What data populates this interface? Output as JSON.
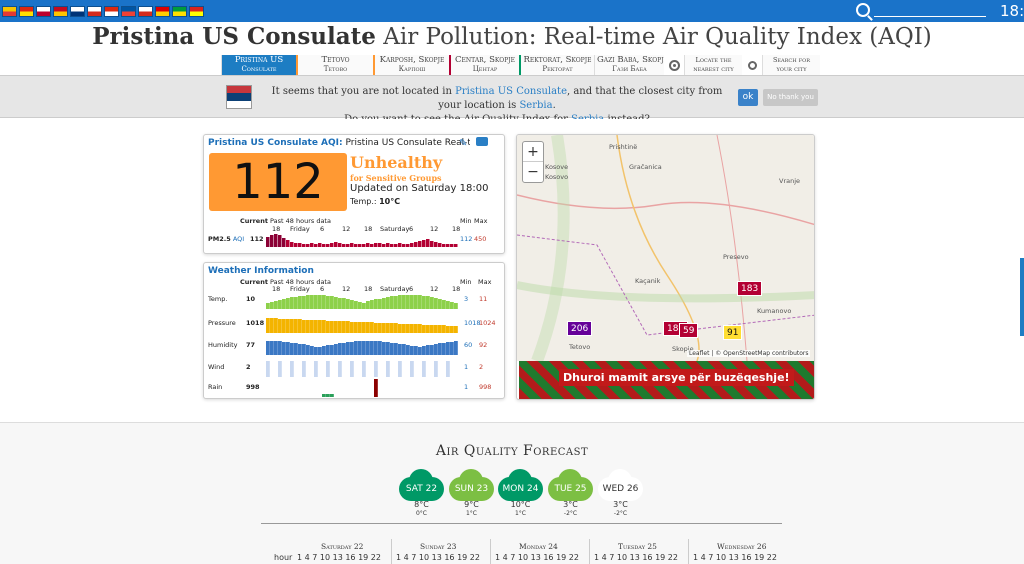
{
  "top_bar": {
    "flag_colors": [
      [
        "#f5c400",
        "#e53935"
      ],
      [
        "#de2910",
        "#ffde00"
      ],
      [
        "#ffffff",
        "#bc002d"
      ],
      [
        "#c60b1e",
        "#ffc400"
      ],
      [
        "#ffffff",
        "#003478"
      ],
      [
        "#ffffff",
        "#d52b1e"
      ],
      [
        "#de2910",
        "#ffffff"
      ],
      [
        "#0055a4",
        "#ef4135"
      ],
      [
        "#ffffff",
        "#d52b1e"
      ],
      [
        "#dd0000",
        "#ffce00"
      ],
      [
        "#009c3b",
        "#ffdf00"
      ],
      [
        "#da251d",
        "#ffff00"
      ]
    ],
    "clock": "18:"
  },
  "page_title": {
    "bold": "Pristina US Consulate",
    "rest": " Air Pollution: Real-time Air Quality Index (AQI)"
  },
  "nav": [
    {
      "label": "Pristina US",
      "sub": "Consulate",
      "active": true,
      "accent": ""
    },
    {
      "label": "Tetovo",
      "sub": "Тетово",
      "active": false,
      "accent": "#ff9933"
    },
    {
      "label": "Karposh, Skopje",
      "sub": "Карпош",
      "active": false,
      "accent": "#ff9933"
    },
    {
      "label": "Centar, Skopje",
      "sub": "Центар",
      "active": false,
      "accent": "#b30033"
    },
    {
      "label": "Rektorat, Skopje",
      "sub": "Ректорат",
      "active": false,
      "accent": "#009966"
    },
    {
      "label": "Gazi Baba, Skopje",
      "sub": "Гази Баба",
      "active": false,
      "accent": ""
    },
    {
      "label": "Locate the",
      "sub": "nearest city",
      "active": false,
      "accent": ""
    },
    {
      "label": "Search for",
      "sub": "your city",
      "active": false,
      "accent": ""
    }
  ],
  "notice": {
    "line1_a": "It seems that you are not located in ",
    "line1_link": "Pristina US Consulate",
    "line1_b": ", and that the closest city from your location is ",
    "line1_link2": "Serbia",
    "line1_c": ".",
    "line2_a": "Do you want to see the Air Quality Index for ",
    "line2_link": "Serbia",
    "line2_b": " instead?",
    "ok": "ok",
    "no": "No thank you"
  },
  "aqi_card": {
    "title_blue": "Pristina US Consulate AQI:",
    "title_rest": " Pristina US Consulate Real-time Air Q",
    "value": "112",
    "status": "Unhealthy",
    "status_sub": "for Sensitive Groups",
    "updated": "Updated on Saturday 18:00",
    "temp_label": "Temp.:",
    "temp_value": "10°C",
    "hdr_current": "Current",
    "hdr_past": "Past 48 hours data",
    "hdr_min": "Min",
    "hdr_max": "Max",
    "pm_label": "PM2.5",
    "pm_unit": "AQI",
    "pm_current": "112",
    "pm_min": "112",
    "pm_max": "450",
    "tick_labels": [
      "18",
      "Friday",
      "6",
      "12",
      "18",
      "Saturday",
      "6",
      "12",
      "18"
    ]
  },
  "weather_card": {
    "title": "Weather Information",
    "hdr_current": "Current",
    "hdr_past": "Past 48 hours data",
    "hdr_min": "Min",
    "hdr_max": "Max",
    "tick_labels": [
      "18",
      "Friday",
      "6",
      "12",
      "18",
      "Saturday",
      "6",
      "12",
      "18"
    ],
    "rows": [
      {
        "label": "Temp.",
        "current": "10",
        "min": "3",
        "max": "11",
        "color": "#8dd14a"
      },
      {
        "label": "Pressure",
        "current": "1018",
        "min": "1018",
        "max": "1024",
        "color": "#f4b400"
      },
      {
        "label": "Humidity",
        "current": "77",
        "min": "60",
        "max": "92",
        "color": "#3b78c4"
      },
      {
        "label": "Wind",
        "current": "2",
        "min": "1",
        "max": "2",
        "color": "#c9d8f0"
      },
      {
        "label": "Rain",
        "current": "998",
        "min": "1",
        "max": "998",
        "color": "#8b0000"
      }
    ]
  },
  "map": {
    "zoom_in": "+",
    "zoom_out": "−",
    "attribution": "Leaflet | © OpenStreetMap contributors",
    "labels": [
      "Prishtinë",
      "Gračanica",
      "Kosove",
      "Kosovo",
      "Kumanovo",
      "Presevo",
      "Tetovo",
      "Skopje",
      "Kaçanik",
      "Vranje"
    ],
    "markers": [
      {
        "value": "206",
        "color": "#660099"
      },
      {
        "value": "182",
        "color": "#b30033"
      },
      {
        "value": "59",
        "color": "#b30033"
      },
      {
        "value": "183",
        "color": "#b30033"
      },
      {
        "value": "91",
        "color": "#ffde33"
      }
    ],
    "ad_text": "Dhuroi mamit arsye për buzëqeshje!"
  },
  "forecast": {
    "title": "Air Quality Forecast",
    "days": [
      {
        "label": "SAT 22",
        "hi": "8°C",
        "lo": "0°C",
        "color": "#009966"
      },
      {
        "label": "SUN 23",
        "hi": "9°C",
        "lo": "1°C",
        "color": "#7cbf43"
      },
      {
        "label": "MON 24",
        "hi": "10°C",
        "lo": "1°C",
        "color": "#009966"
      },
      {
        "label": "TUE 25",
        "hi": "3°C",
        "lo": "-2°C",
        "color": "#7cbf43"
      },
      {
        "label": "WED 26",
        "hi": "3°C",
        "lo": "-2°C",
        "color": "#ffffff"
      }
    ],
    "hour_label": "hour",
    "day_headers": [
      "Saturday 22",
      "Sunday 23",
      "Monday 24",
      "Tuesday 25",
      "Wednesday 26"
    ],
    "hours": "1  4  7  10 13 16 19 22"
  }
}
